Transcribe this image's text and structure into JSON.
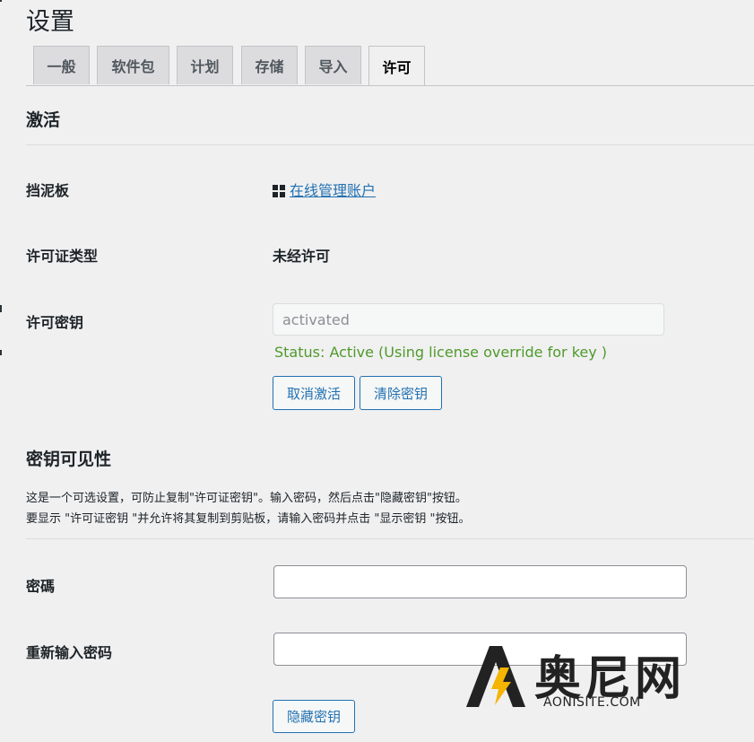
{
  "page": {
    "title": "设置"
  },
  "tabs": [
    {
      "label": "一般"
    },
    {
      "label": "软件包"
    },
    {
      "label": "计划"
    },
    {
      "label": "存储"
    },
    {
      "label": "导入"
    },
    {
      "label": "许可"
    }
  ],
  "activation": {
    "title": "激活",
    "dashboard": {
      "label": "挡泥板",
      "link_text": "在线管理账户",
      "icon": "dashboard-grid-icon"
    },
    "license_type": {
      "label": "许可证类型",
      "value": "未经许可"
    },
    "license_key": {
      "label": "许可密钥",
      "value": "activated",
      "status": "Status: Active (Using license override for key )"
    },
    "buttons": {
      "deactivate": "取消激活",
      "clear_key": "清除密钥"
    }
  },
  "visibility": {
    "title": "密钥可见性",
    "desc_line1": "这是一个可选设置，可防止复制\"许可证密钥\"。输入密码，然后点击\"隐藏密钥\"按钮。",
    "desc_line2": "要显示 \"许可证密钥 \"并允许将其复制到剪贴板，请输入密码并点击 \"显示密钥 \"按钮。",
    "password": {
      "label": "密碼",
      "value": ""
    },
    "retype_password": {
      "label": "重新输入密码",
      "value": ""
    },
    "hide_key_button": "隐藏密钥"
  },
  "watermark": {
    "text": "奥尼网",
    "sub": "AONISITE.COM"
  },
  "colors": {
    "accent": "#2271b1",
    "status_green": "#4f9a2a",
    "background": "#f0f0f1",
    "watermark_yellow": "#f5b400"
  }
}
